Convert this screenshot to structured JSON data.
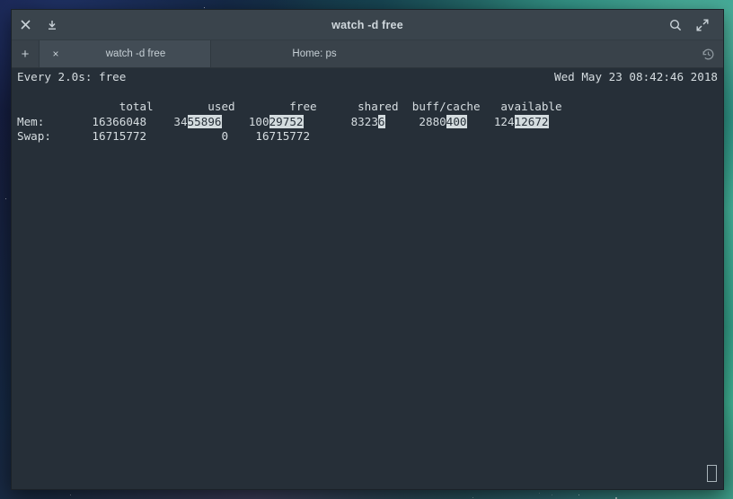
{
  "window": {
    "title": "watch -d free",
    "close_icon": "close-icon",
    "minimize_icon": "minimize-down-icon",
    "search_icon": "search-icon",
    "maximize_icon": "maximize-icon"
  },
  "tabbar": {
    "new_tab_label": "+",
    "history_icon": "history-icon",
    "tabs": [
      {
        "label": "watch -d free",
        "close_label": "×",
        "active": true
      },
      {
        "label": "Home: ps",
        "close_label": "",
        "active": false
      }
    ]
  },
  "terminal": {
    "header_left": "Every 2.0s: free",
    "header_right": "Wed May 23 08:42:46 2018",
    "columns_line": "               total        used        free      shared  buff/cache   available",
    "mem_row": {
      "label": "Mem:   ",
      "total": "    16366048",
      "used_plain": "    34",
      "used_hl": "55896",
      "free_plain": "    100",
      "free_hl": "29752",
      "shared_plain": "       8323",
      "shared_hl": "6",
      "buffcache_plain": "     2880",
      "buffcache_hl": "400",
      "available_plain": "    124",
      "available_hl": "12672"
    },
    "swap_row": "Swap:      16715772           0    16715772",
    "cursor": "block-cursor"
  },
  "colors": {
    "terminal_bg": "#262f38",
    "terminal_fg": "#d6dde1",
    "highlight_bg": "#d4dcdf",
    "highlight_fg": "#262f38",
    "titlebar_bg": "#3a444c",
    "tabbar_bg": "#39424a",
    "active_tab_bg": "#424c55"
  }
}
